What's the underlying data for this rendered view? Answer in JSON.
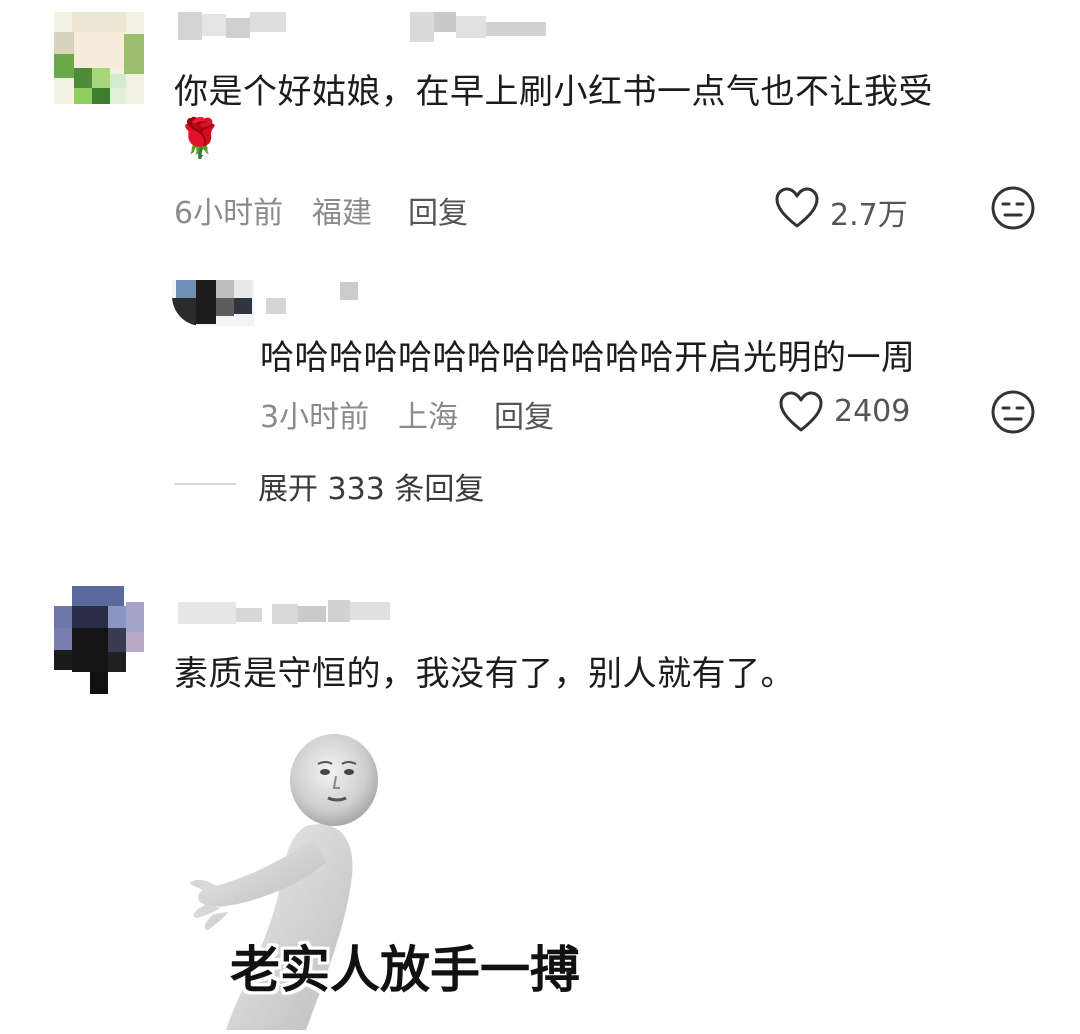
{
  "comments": [
    {
      "text": "你是个好姑娘，在早上刷小红书一点气也不让我受",
      "emoji": "🌹",
      "time": "6小时前",
      "location": "福建",
      "reply_label": "回复",
      "likes": "2.7万",
      "reply": {
        "text": "哈哈哈哈哈哈哈哈哈哈哈哈开启光明的一周",
        "time": "3小时前",
        "location": "上海",
        "reply_label": "回复",
        "likes": "2409"
      },
      "expand_label": "展开 333 条回复"
    },
    {
      "text": "素质是守恒的，我没有了，别人就有了。",
      "sticker_caption": "老实人放手一搏"
    }
  ],
  "icons": {
    "like": "heart-icon",
    "emoji_react": "expressionless-face-icon"
  },
  "colors": {
    "text": "#1c1c1c",
    "meta": "#8b8b8b",
    "icon": "#333333"
  }
}
